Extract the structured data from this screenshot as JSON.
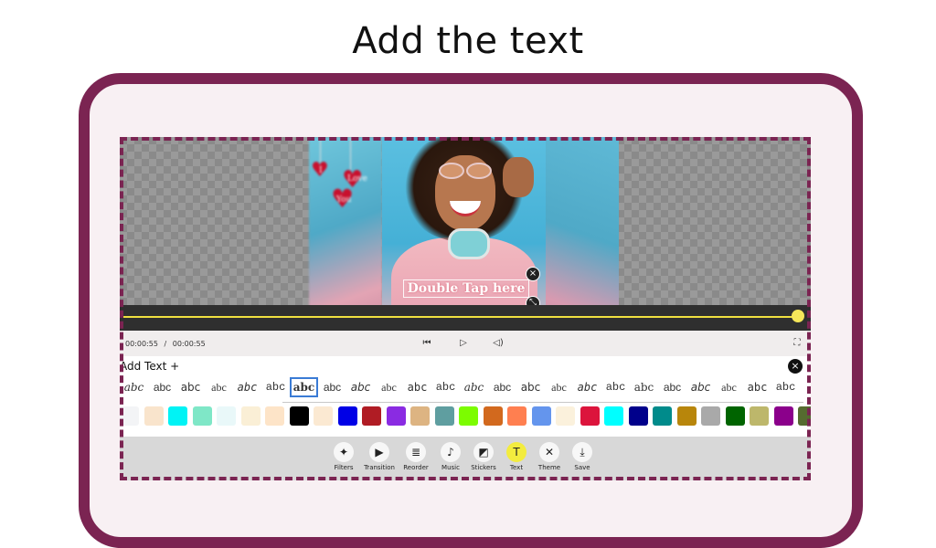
{
  "heading": "Add the text",
  "preview": {
    "hearts": [
      "I",
      "Love",
      "You"
    ],
    "overlay_text": "Double Tap here",
    "close_icon": "×",
    "resize_icon": "⤡"
  },
  "playback": {
    "current_time": "00:00:55",
    "separator": "/",
    "total_time": "00:00:55",
    "progress": 1.0
  },
  "text_panel": {
    "title": "Add Text +",
    "close_icon": "×",
    "fonts": [
      "abc",
      "abc",
      "abc",
      "abc",
      "abc",
      "abc",
      "abc",
      "abc",
      "abc",
      "abc",
      "abc",
      "abc",
      "abc",
      "abc",
      "abc",
      "abc",
      "abc",
      "abc",
      "abc",
      "abc",
      "abc",
      "abc",
      "abc",
      "abc"
    ],
    "selected_font_index": 6,
    "colors": [
      "#f3f4f6",
      "#f9e4cc",
      "#00f3f5",
      "#7fe7c7",
      "#e9f8f9",
      "#faefd6",
      "#fde4c8",
      "#000000",
      "#fbe9d2",
      "#0000e6",
      "#b01c24",
      "#8a2be2",
      "#ddb482",
      "#5f9ea0",
      "#7cfc00",
      "#d2691e",
      "#ff7f50",
      "#6495ed",
      "#fbf1dc",
      "#dc143c",
      "#00ffff",
      "#00008b",
      "#008b8b",
      "#b8860b",
      "#a9a9a9",
      "#006400",
      "#bdb76b",
      "#8b008b",
      "#556b2f"
    ]
  },
  "toolbar": [
    {
      "label": "Filters",
      "icon": "✦",
      "active": false
    },
    {
      "label": "Transition",
      "icon": "▶",
      "active": false
    },
    {
      "label": "Reorder",
      "icon": "≣",
      "active": false
    },
    {
      "label": "Music",
      "icon": "♪",
      "active": false
    },
    {
      "label": "Stickers",
      "icon": "◩",
      "active": false
    },
    {
      "label": "Text",
      "icon": "T",
      "active": true
    },
    {
      "label": "Theme",
      "icon": "✕",
      "active": false
    },
    {
      "label": "Save",
      "icon": "⤓",
      "active": false
    }
  ],
  "accent": "#7b2452"
}
